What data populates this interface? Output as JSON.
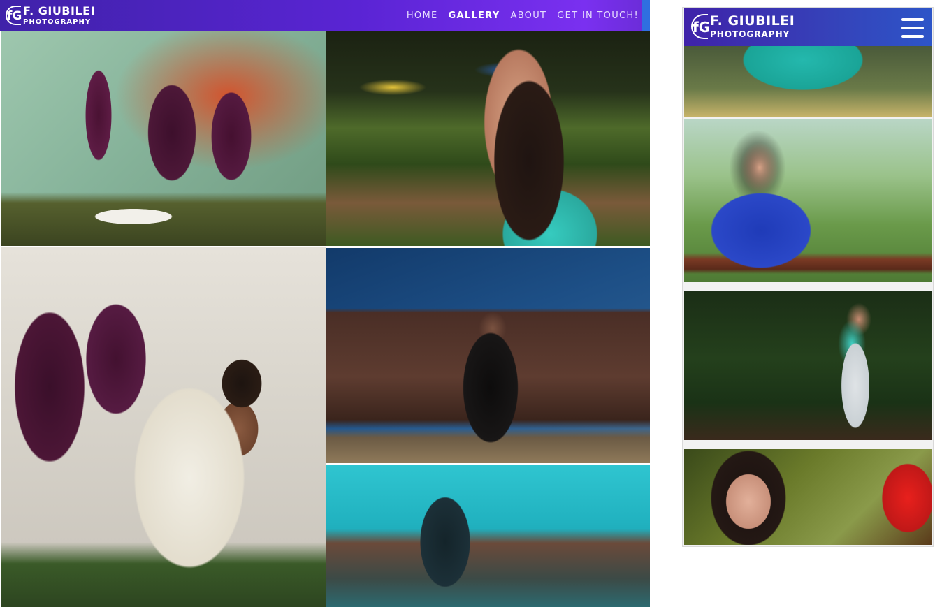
{
  "brand": {
    "name": "F. GIUBILEI",
    "tagline": "PHOTOGRAPHY",
    "mark": "fG"
  },
  "nav": {
    "items": [
      {
        "label": "HOME",
        "active": false
      },
      {
        "label": "GALLERY",
        "active": true
      },
      {
        "label": "ABOUT",
        "active": false
      },
      {
        "label": "GET IN TOUCH!",
        "active": false
      }
    ]
  },
  "colors": {
    "nav_gradient_start": "#3f22a9",
    "nav_gradient_end": "#7a30f0",
    "nav_text": "#ffffff"
  },
  "gallery": {
    "photos": [
      {
        "subject": "man reclining in lounge chair by graffiti wall"
      },
      {
        "subject": "woman with long dark hair in turquoise dress, garden"
      },
      {
        "subject": "man seated in folding chair by cactus mural"
      },
      {
        "subject": "man in black seated inside excavator bucket"
      },
      {
        "subject": "double exposure figure over turquoise town"
      }
    ]
  },
  "mobile": {
    "menu_icon": "hamburger-menu-icon",
    "photos": [
      {
        "subject": "woman in turquoise top, cropped"
      },
      {
        "subject": "woman in blue off-shoulder dress leaning on rail"
      },
      {
        "subject": "woman in turquoise top standing by foliage"
      },
      {
        "subject": "close-up of woman with red flower in hair"
      }
    ]
  }
}
